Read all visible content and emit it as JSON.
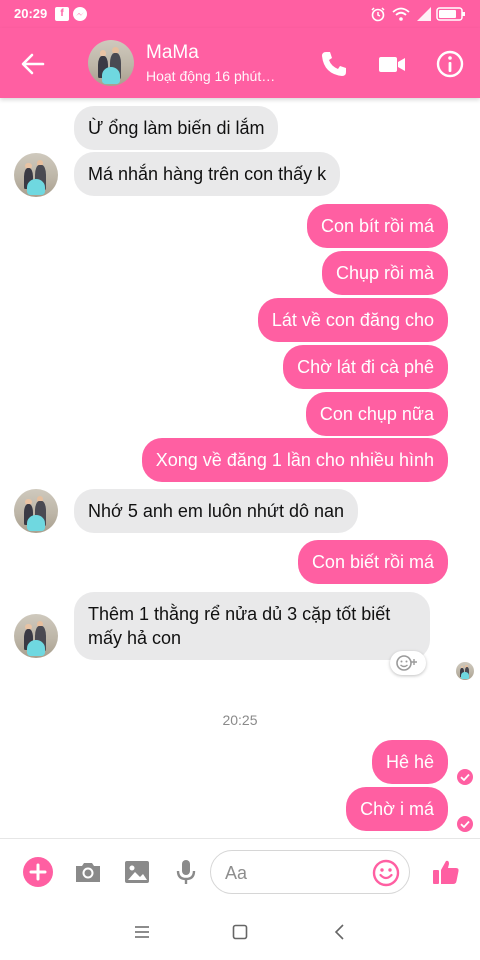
{
  "status_bar": {
    "time": "20:29"
  },
  "header": {
    "contact_name": "MaMa",
    "contact_status": "Hoạt động 16 phút…"
  },
  "messages": [
    {
      "side": "in",
      "text": "Ừ  ổng làm biến di lắm"
    },
    {
      "side": "in",
      "text": "Má nhắn hàng trên con thấy k"
    },
    {
      "side": "out",
      "text": "Con bít rồi má"
    },
    {
      "side": "out",
      "text": "Chụp rồi mà"
    },
    {
      "side": "out",
      "text": "Lát về con đăng cho"
    },
    {
      "side": "out",
      "text": "Chờ lát đi cà phê"
    },
    {
      "side": "out",
      "text": "Con chụp nữa"
    },
    {
      "side": "out",
      "text": "Xong về đăng 1 lần cho nhiều hình"
    },
    {
      "side": "in",
      "text": "Nhớ 5 anh em luôn nhứt dô nan"
    },
    {
      "side": "out",
      "text": "Con biết rồi má"
    },
    {
      "side": "in",
      "text_line1": "Thêm 1 thằng rể nửa dủ 3 cặp tốt biết",
      "text_line2": "mấy hả con"
    },
    {
      "side": "out",
      "text": "Hê hê"
    },
    {
      "side": "out",
      "text": "Chờ i má"
    }
  ],
  "timestamp": "20:25",
  "composer": {
    "placeholder": "Aa"
  },
  "icons": {
    "back": "arrow-left-icon",
    "call": "phone-icon",
    "video": "video-camera-icon",
    "info": "info-icon",
    "add": "plus-icon",
    "camera": "camera-icon",
    "gallery": "image-icon",
    "mic": "microphone-icon",
    "emoji": "smiley-icon",
    "like": "thumbs-up-icon"
  },
  "colors": {
    "accent": "#ff5fa2",
    "incoming_bubble": "#e9e9ea",
    "icon_gray": "#8a8a8a"
  }
}
